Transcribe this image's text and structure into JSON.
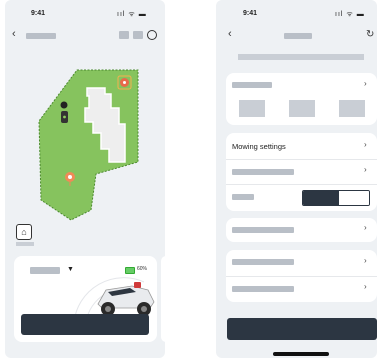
{
  "left_screen": {
    "status_time": "9:41",
    "status_icons": "ııl ᯤ ▬",
    "back_icon": "chevron-left-icon",
    "header_icons": [
      "map-layer-icon",
      "grid-icon",
      "settings-icon"
    ],
    "map_home_icon": "home-upload-icon",
    "mower_card": {
      "battery_text": "60%",
      "dropdown_icon": "caret-down-icon"
    }
  },
  "right_screen": {
    "status_time": "9:41",
    "status_icons": "ııl ᯤ ▬",
    "back_icon": "chevron-left-icon",
    "header_action_icon": "refresh-icon",
    "settings_sections": {
      "mowing_settings_label": "Mowing settings"
    }
  }
}
